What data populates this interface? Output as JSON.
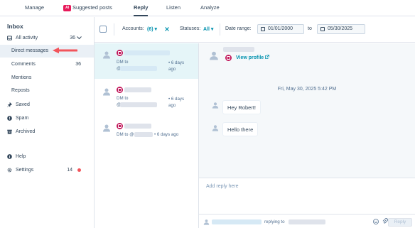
{
  "tabs": {
    "manage": "Manage",
    "ai_badge": "AI",
    "suggested": "Suggested posts",
    "reply": "Reply",
    "listen": "Listen",
    "analyze": "Analyze"
  },
  "sidebar": {
    "title": "Inbox",
    "all_activity": {
      "label": "All activity",
      "count": "36"
    },
    "direct_messages": "Direct messages",
    "comments": {
      "label": "Comments",
      "count": "36"
    },
    "mentions": "Mentions",
    "reposts": "Reposts",
    "saved": "Saved",
    "spam": "Spam",
    "archived": "Archived",
    "help": "Help",
    "settings": {
      "label": "Settings",
      "count": "14"
    }
  },
  "filters": {
    "accounts_label": "Accounts:",
    "accounts_value": "(6)",
    "statuses_label": "Statuses:",
    "statuses_value": "All",
    "date_range_label": "Date range:",
    "date_from": "01/01/2000",
    "to_label": "to",
    "date_to": "05/30/2025"
  },
  "conversations": [
    {
      "dm_to": "DM to",
      "at": "@",
      "time": "• 6 days ago"
    },
    {
      "dm_to": "DM to",
      "at": "@",
      "time": "• 6 days ago"
    },
    {
      "dm_to": "DM to @",
      "time": "• 6 days ago"
    }
  ],
  "thread": {
    "view_profile": "View profile",
    "timestamp": "Fri, May 30, 2025 5:42 PM",
    "messages": [
      "Hey Robert!",
      "Hello there"
    ]
  },
  "reply": {
    "placeholder": "Add reply here",
    "replying_to": "replying to",
    "button": "Reply"
  },
  "colors": {
    "accent": "#0091ae",
    "instagram": "#c2185b",
    "arrow": "#f2545b",
    "selected_bg": "#e5f5f8"
  }
}
